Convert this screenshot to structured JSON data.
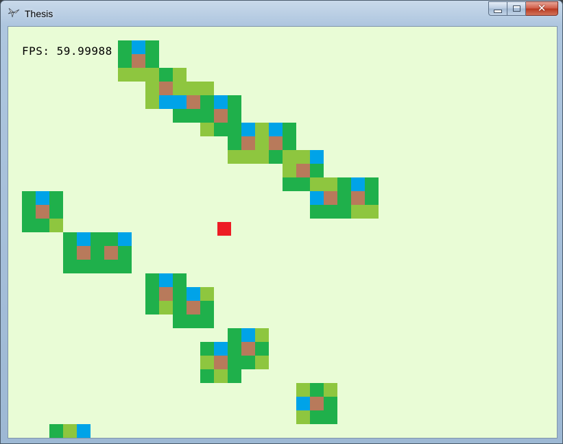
{
  "window": {
    "title": "Thesis",
    "icon": "pinwheel-app-icon",
    "controls": {
      "minimize_icon": "minimize-icon",
      "maximize_icon": "maximize-icon",
      "close_icon": "close-icon",
      "close_glyph": "✕"
    }
  },
  "hud": {
    "fps_text": "FPS: 59.99988"
  },
  "palette": {
    "background": "#e9fcd6",
    "G": "#1fb04b",
    "L": "#8ec63f",
    "B": "#00a3e8",
    "R": "#b87a5b",
    "player": "#ed1c24"
  },
  "game": {
    "tile_size_label": "20px grid",
    "tiles": [
      {
        "c": 8,
        "r": 1,
        "k": "G"
      },
      {
        "c": 9,
        "r": 1,
        "k": "B"
      },
      {
        "c": 10,
        "r": 1,
        "k": "G"
      },
      {
        "c": 8,
        "r": 2,
        "k": "G"
      },
      {
        "c": 9,
        "r": 2,
        "k": "R"
      },
      {
        "c": 10,
        "r": 2,
        "k": "G"
      },
      {
        "c": 8,
        "r": 3,
        "k": "L"
      },
      {
        "c": 9,
        "r": 3,
        "k": "L"
      },
      {
        "c": 10,
        "r": 3,
        "k": "L"
      },
      {
        "c": 11,
        "r": 3,
        "k": "G"
      },
      {
        "c": 12,
        "r": 3,
        "k": "L"
      },
      {
        "c": 10,
        "r": 4,
        "k": "L"
      },
      {
        "c": 11,
        "r": 4,
        "k": "R"
      },
      {
        "c": 12,
        "r": 4,
        "k": "L"
      },
      {
        "c": 13,
        "r": 4,
        "k": "L"
      },
      {
        "c": 14,
        "r": 4,
        "k": "L"
      },
      {
        "c": 10,
        "r": 5,
        "k": "L"
      },
      {
        "c": 11,
        "r": 5,
        "k": "B"
      },
      {
        "c": 12,
        "r": 5,
        "k": "B"
      },
      {
        "c": 13,
        "r": 5,
        "k": "R"
      },
      {
        "c": 14,
        "r": 5,
        "k": "G"
      },
      {
        "c": 15,
        "r": 5,
        "k": "B"
      },
      {
        "c": 16,
        "r": 5,
        "k": "G"
      },
      {
        "c": 12,
        "r": 6,
        "k": "G"
      },
      {
        "c": 13,
        "r": 6,
        "k": "G"
      },
      {
        "c": 14,
        "r": 6,
        "k": "G"
      },
      {
        "c": 15,
        "r": 6,
        "k": "R"
      },
      {
        "c": 16,
        "r": 6,
        "k": "G"
      },
      {
        "c": 14,
        "r": 7,
        "k": "L"
      },
      {
        "c": 15,
        "r": 7,
        "k": "G"
      },
      {
        "c": 16,
        "r": 7,
        "k": "G"
      },
      {
        "c": 17,
        "r": 7,
        "k": "B"
      },
      {
        "c": 18,
        "r": 7,
        "k": "L"
      },
      {
        "c": 19,
        "r": 7,
        "k": "B"
      },
      {
        "c": 20,
        "r": 7,
        "k": "G"
      },
      {
        "c": 16,
        "r": 8,
        "k": "G"
      },
      {
        "c": 17,
        "r": 8,
        "k": "R"
      },
      {
        "c": 18,
        "r": 8,
        "k": "L"
      },
      {
        "c": 19,
        "r": 8,
        "k": "R"
      },
      {
        "c": 20,
        "r": 8,
        "k": "G"
      },
      {
        "c": 16,
        "r": 9,
        "k": "L"
      },
      {
        "c": 17,
        "r": 9,
        "k": "L"
      },
      {
        "c": 18,
        "r": 9,
        "k": "L"
      },
      {
        "c": 19,
        "r": 9,
        "k": "G"
      },
      {
        "c": 20,
        "r": 9,
        "k": "L"
      },
      {
        "c": 21,
        "r": 9,
        "k": "L"
      },
      {
        "c": 22,
        "r": 9,
        "k": "B"
      },
      {
        "c": 20,
        "r": 10,
        "k": "L"
      },
      {
        "c": 21,
        "r": 10,
        "k": "R"
      },
      {
        "c": 22,
        "r": 10,
        "k": "G"
      },
      {
        "c": 20,
        "r": 11,
        "k": "G"
      },
      {
        "c": 21,
        "r": 11,
        "k": "G"
      },
      {
        "c": 22,
        "r": 11,
        "k": "L"
      },
      {
        "c": 23,
        "r": 11,
        "k": "L"
      },
      {
        "c": 24,
        "r": 11,
        "k": "G"
      },
      {
        "c": 25,
        "r": 11,
        "k": "B"
      },
      {
        "c": 26,
        "r": 11,
        "k": "G"
      },
      {
        "c": 22,
        "r": 12,
        "k": "B"
      },
      {
        "c": 23,
        "r": 12,
        "k": "R"
      },
      {
        "c": 24,
        "r": 12,
        "k": "G"
      },
      {
        "c": 25,
        "r": 12,
        "k": "R"
      },
      {
        "c": 26,
        "r": 12,
        "k": "G"
      },
      {
        "c": 22,
        "r": 13,
        "k": "G"
      },
      {
        "c": 23,
        "r": 13,
        "k": "G"
      },
      {
        "c": 24,
        "r": 13,
        "k": "G"
      },
      {
        "c": 25,
        "r": 13,
        "k": "L"
      },
      {
        "c": 26,
        "r": 13,
        "k": "L"
      },
      {
        "c": 1,
        "r": 12,
        "k": "G"
      },
      {
        "c": 2,
        "r": 12,
        "k": "B"
      },
      {
        "c": 3,
        "r": 12,
        "k": "G"
      },
      {
        "c": 1,
        "r": 13,
        "k": "G"
      },
      {
        "c": 2,
        "r": 13,
        "k": "R"
      },
      {
        "c": 3,
        "r": 13,
        "k": "G"
      },
      {
        "c": 1,
        "r": 14,
        "k": "G"
      },
      {
        "c": 2,
        "r": 14,
        "k": "G"
      },
      {
        "c": 3,
        "r": 14,
        "k": "L"
      },
      {
        "c": 4,
        "r": 15,
        "k": "G"
      },
      {
        "c": 5,
        "r": 15,
        "k": "B"
      },
      {
        "c": 6,
        "r": 15,
        "k": "G"
      },
      {
        "c": 7,
        "r": 15,
        "k": "G"
      },
      {
        "c": 8,
        "r": 15,
        "k": "B"
      },
      {
        "c": 4,
        "r": 16,
        "k": "G"
      },
      {
        "c": 5,
        "r": 16,
        "k": "R"
      },
      {
        "c": 6,
        "r": 16,
        "k": "G"
      },
      {
        "c": 7,
        "r": 16,
        "k": "R"
      },
      {
        "c": 8,
        "r": 16,
        "k": "G"
      },
      {
        "c": 4,
        "r": 17,
        "k": "G"
      },
      {
        "c": 5,
        "r": 17,
        "k": "G"
      },
      {
        "c": 6,
        "r": 17,
        "k": "G"
      },
      {
        "c": 7,
        "r": 17,
        "k": "G"
      },
      {
        "c": 8,
        "r": 17,
        "k": "G"
      },
      {
        "c": 10,
        "r": 18,
        "k": "G"
      },
      {
        "c": 11,
        "r": 18,
        "k": "B"
      },
      {
        "c": 12,
        "r": 18,
        "k": "G"
      },
      {
        "c": 10,
        "r": 19,
        "k": "G"
      },
      {
        "c": 11,
        "r": 19,
        "k": "R"
      },
      {
        "c": 12,
        "r": 19,
        "k": "G"
      },
      {
        "c": 13,
        "r": 19,
        "k": "B"
      },
      {
        "c": 14,
        "r": 19,
        "k": "L"
      },
      {
        "c": 10,
        "r": 20,
        "k": "G"
      },
      {
        "c": 11,
        "r": 20,
        "k": "L"
      },
      {
        "c": 12,
        "r": 20,
        "k": "G"
      },
      {
        "c": 13,
        "r": 20,
        "k": "R"
      },
      {
        "c": 14,
        "r": 20,
        "k": "G"
      },
      {
        "c": 12,
        "r": 21,
        "k": "G"
      },
      {
        "c": 13,
        "r": 21,
        "k": "G"
      },
      {
        "c": 14,
        "r": 21,
        "k": "G"
      },
      {
        "c": 16,
        "r": 22,
        "k": "G"
      },
      {
        "c": 17,
        "r": 22,
        "k": "B"
      },
      {
        "c": 18,
        "r": 22,
        "k": "L"
      },
      {
        "c": 14,
        "r": 23,
        "k": "G"
      },
      {
        "c": 15,
        "r": 23,
        "k": "B"
      },
      {
        "c": 16,
        "r": 23,
        "k": "G"
      },
      {
        "c": 17,
        "r": 23,
        "k": "R"
      },
      {
        "c": 18,
        "r": 23,
        "k": "G"
      },
      {
        "c": 14,
        "r": 24,
        "k": "L"
      },
      {
        "c": 15,
        "r": 24,
        "k": "R"
      },
      {
        "c": 16,
        "r": 24,
        "k": "G"
      },
      {
        "c": 17,
        "r": 24,
        "k": "G"
      },
      {
        "c": 18,
        "r": 24,
        "k": "L"
      },
      {
        "c": 14,
        "r": 25,
        "k": "G"
      },
      {
        "c": 15,
        "r": 25,
        "k": "L"
      },
      {
        "c": 16,
        "r": 25,
        "k": "G"
      },
      {
        "c": 21,
        "r": 26,
        "k": "L"
      },
      {
        "c": 22,
        "r": 26,
        "k": "G"
      },
      {
        "c": 23,
        "r": 26,
        "k": "L"
      },
      {
        "c": 21,
        "r": 27,
        "k": "B"
      },
      {
        "c": 22,
        "r": 27,
        "k": "R"
      },
      {
        "c": 23,
        "r": 27,
        "k": "G"
      },
      {
        "c": 21,
        "r": 28,
        "k": "L"
      },
      {
        "c": 22,
        "r": 28,
        "k": "G"
      },
      {
        "c": 23,
        "r": 28,
        "k": "G"
      },
      {
        "c": 3,
        "r": 29,
        "k": "G"
      },
      {
        "c": 4,
        "r": 29,
        "k": "L"
      },
      {
        "c": 5,
        "r": 29,
        "k": "B"
      }
    ],
    "player": {
      "x_grid": 15.25,
      "y_grid": 14.25
    }
  }
}
